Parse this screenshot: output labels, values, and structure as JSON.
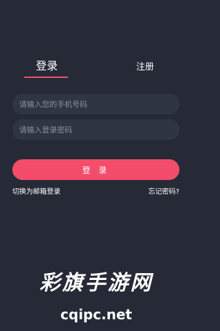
{
  "tabs": {
    "login_label": "登录",
    "register_label": "注册",
    "active_indicator_color": "#f2506e"
  },
  "form": {
    "phone_placeholder": "请输入您的手机号码",
    "password_placeholder": "请输入登录密码",
    "submit_label": "登 录",
    "submit_color": "#f44c6b"
  },
  "links": {
    "switch_email": "切换为邮箱登录",
    "forgot_password": "忘记密码?"
  },
  "watermark": {
    "title": "彩旗手游网",
    "url": "cqipc.net"
  }
}
